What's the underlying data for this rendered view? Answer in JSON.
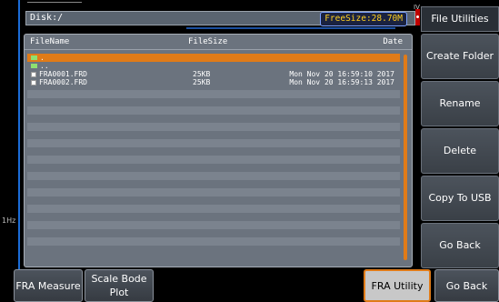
{
  "path_bar": {
    "path": "Disk:/",
    "free_size": "FreeSize:28.70M"
  },
  "side_labels": {
    "hz": "1Hz",
    "iv": "IV"
  },
  "file_list": {
    "headers": {
      "name": "FileName",
      "size": "FileSize",
      "date": "Date"
    },
    "rows": [
      {
        "name": ".",
        "size": "",
        "date": "",
        "kind": "folder",
        "selected": true
      },
      {
        "name": "..",
        "size": "",
        "date": "",
        "kind": "folder",
        "selected": false
      },
      {
        "name": "FRA0001.FRD",
        "size": "25KB",
        "date": "Mon Nov 20 16:59:10 2017",
        "kind": "file",
        "selected": false
      },
      {
        "name": "FRA0002.FRD",
        "size": "25KB",
        "date": "Mon Nov 20 16:59:13 2017",
        "kind": "file",
        "selected": false
      }
    ]
  },
  "right_menu": {
    "title": "File Utilities",
    "buttons": [
      "Create Folder",
      "Rename",
      "Delete",
      "Copy To USB",
      "Go Back"
    ]
  },
  "bottom_menu": {
    "fra_measure": "FRA Measure",
    "scale_bode_plot": "Scale Bode Plot",
    "fra_utility": "FRA Utility",
    "go_back": "Go Back"
  },
  "colors": {
    "accent": "#e07b18",
    "folder": "#8fe070",
    "free_size_text": "#ffd020"
  }
}
